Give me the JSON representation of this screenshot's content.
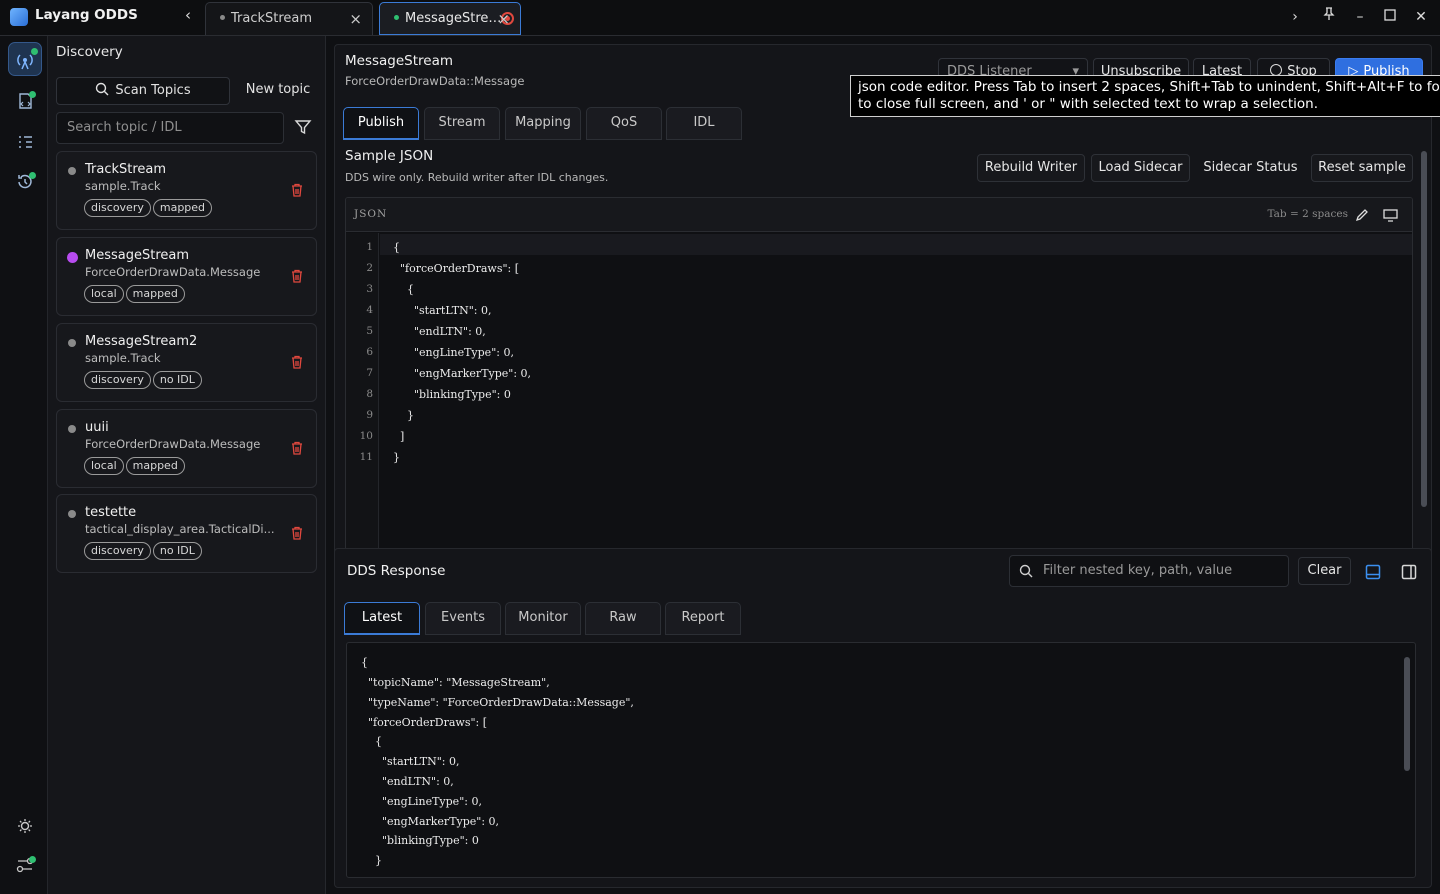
{
  "app": {
    "title": "Layang ODDS"
  },
  "tabs": [
    {
      "label": "TrackStream",
      "close": "×"
    },
    {
      "label": "MessageStre…",
      "close": "×"
    }
  ],
  "sidebar": {
    "title": "Discovery",
    "scan_label": "Scan Topics",
    "new_topic_label": "New topic",
    "search_placeholder": "Search topic / IDL",
    "topics": [
      {
        "name": "TrackStream",
        "type": "sample.Track",
        "chips": [
          "discovery",
          "mapped"
        ],
        "status": "idle"
      },
      {
        "name": "MessageStream",
        "type": "ForceOrderDrawData.Message",
        "chips": [
          "local",
          "mapped"
        ],
        "status": "active"
      },
      {
        "name": "MessageStream2",
        "type": "sample.Track",
        "chips": [
          "discovery",
          "no IDL"
        ],
        "status": "idle"
      },
      {
        "name": "uuii",
        "type": "ForceOrderDrawData.Message",
        "chips": [
          "local",
          "mapped"
        ],
        "status": "idle"
      },
      {
        "name": "testette",
        "type": "tactical_display_area.TacticalDi...",
        "chips": [
          "discovery",
          "no IDL"
        ],
        "status": "idle"
      }
    ]
  },
  "editor": {
    "title": "MessageStream",
    "subtitle": "ForceOrderDrawData::Message",
    "listener_select": "DDS Listener",
    "buttons": {
      "unsubscribe": "Unsubscribe",
      "latest": "Latest",
      "stop": "Stop",
      "publish": "Publish"
    },
    "tooltip_line1": "json code editor. Press Tab to insert 2 spaces, Shift+Tab to unindent, Shift+Alt+F to format",
    "tooltip_line2": "to close full screen, and ' or \" with selected text to wrap a selection.",
    "tabs": [
      "Publish",
      "Stream",
      "Mapping",
      "QoS",
      "IDL"
    ],
    "section_title": "Sample JSON",
    "section_sub": "DDS wire only. Rebuild writer after IDL changes.",
    "actions": [
      "Rebuild Writer",
      "Load Sidecar",
      "Sidecar Status",
      "Reset sample"
    ],
    "code_label": "JSON",
    "tab_info": "Tab = 2 spaces",
    "code_lines": [
      "{",
      "  \"forceOrderDraws\": [",
      "    {",
      "      \"startLTN\": 0,",
      "      \"endLTN\": 0,",
      "      \"engLineType\": 0,",
      "      \"engMarkerType\": 0,",
      "      \"blinkingType\": 0",
      "    }",
      "  ]",
      "}"
    ]
  },
  "response": {
    "title": "DDS Response",
    "filter_placeholder": "Filter nested key, path, value",
    "clear_label": "Clear",
    "tabs": [
      "Latest",
      "Events",
      "Monitor",
      "Raw",
      "Report"
    ],
    "lines": [
      "{",
      "  \"topicName\": \"MessageStream\",",
      "  \"typeName\": \"ForceOrderDrawData::Message\",",
      "  \"forceOrderDraws\": [",
      "    {",
      "      \"startLTN\": 0,",
      "      \"endLTN\": 0,",
      "      \"engLineType\": 0,",
      "      \"engMarkerType\": 0,",
      "      \"blinkingType\": 0",
      "    }"
    ]
  },
  "colors": {
    "accent": "#3b7bd6",
    "publish": "#2f6fe0",
    "status_active": "#b84cf0",
    "danger": "#e0483e",
    "online": "#2fbf71"
  }
}
